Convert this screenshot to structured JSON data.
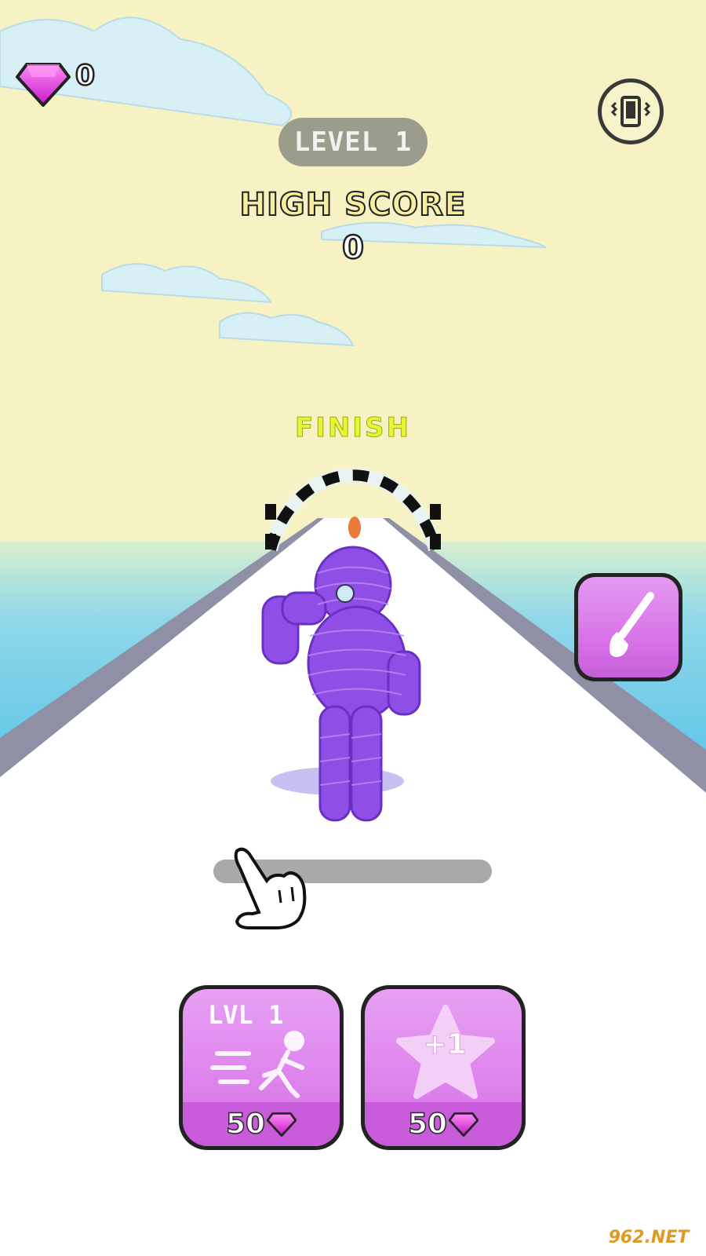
{
  "hud": {
    "gems": "0",
    "level_label": "LEVEL 1",
    "high_score_label": "HIGH SCORE",
    "high_score_value": "0",
    "gem_icon": "gem-icon",
    "vibrate_icon": "vibrate-icon",
    "brush_icon": "paintbrush-icon"
  },
  "scene": {
    "finish_label": "FINISH",
    "character": "purple rope character"
  },
  "tutorial": {
    "hand_icon": "pointing-hand-icon"
  },
  "shop": {
    "speed": {
      "title": "LVL 1",
      "price": "50",
      "icon": "running-man-icon"
    },
    "income": {
      "badge": "+1",
      "price": "50",
      "icon": "star-icon"
    }
  },
  "watermark": "962.NET",
  "colors": {
    "sky": "#f6f2c4",
    "sea": "#6cc8e8",
    "track": "#ffffff",
    "rail": "#8f8fa5",
    "character": "#8f4fe6",
    "button": "#d776e8",
    "gem": "#e23bd8"
  }
}
